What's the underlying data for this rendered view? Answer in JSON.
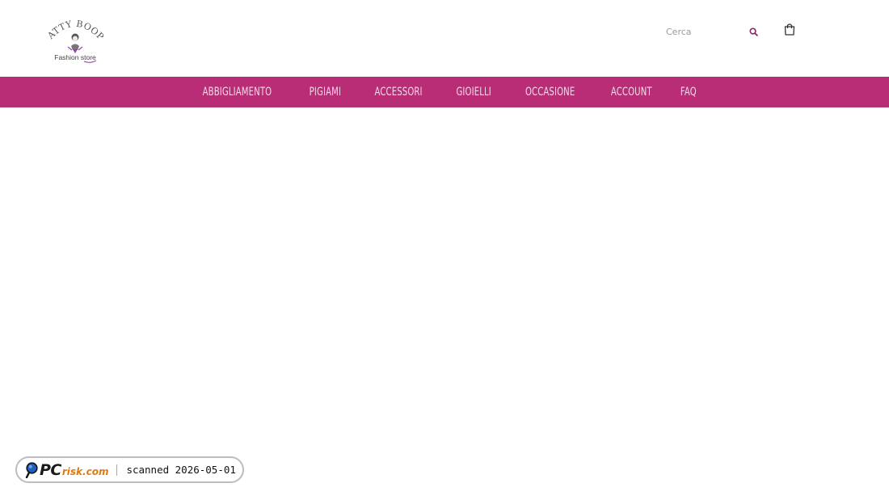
{
  "header": {
    "logo": {
      "top_text": "PATTY BOOP!",
      "bottom_text": "Fashion store"
    },
    "search": {
      "placeholder": "Cerca"
    }
  },
  "nav": {
    "items": [
      {
        "label": "ABBIGLIAMENTO"
      },
      {
        "label": "PIGIAMI"
      },
      {
        "label": "ACCESSORI"
      },
      {
        "label": "GIOIELLI"
      },
      {
        "label": "OCCASIONE"
      },
      {
        "label": "ACCOUNT"
      },
      {
        "label": "FAQ"
      }
    ]
  },
  "badge": {
    "brand_pc": "PC",
    "brand_risk": "risk.com",
    "scan_text": "scanned 2026-05-01"
  },
  "colors": {
    "accent": "#b92d76",
    "nav_text": "#f4dbe8",
    "background": "#ffffff"
  },
  "icons": {
    "search": "search-icon",
    "cart": "shopping-bag-icon",
    "badge": "magnifier-icon"
  }
}
